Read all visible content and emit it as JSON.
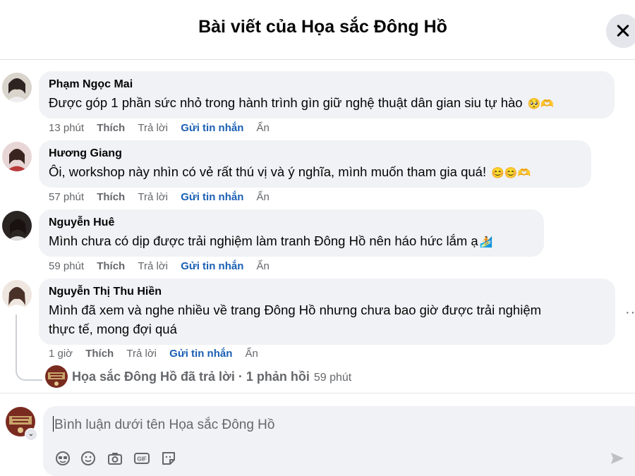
{
  "header": {
    "title": "Bài viết của Họa sắc Đông Hồ"
  },
  "comments": [
    {
      "author": "Phạm Ngọc Mai",
      "text": "Được góp 1 phần sức nhỏ trong hành trình gìn giữ nghệ thuật dân gian siu tự hào",
      "emoji": "🥺🫶",
      "time": "13 phút",
      "like": "Thích",
      "reply": "Trả lời",
      "message": "Gửi tin nhắn",
      "hide": "Ẩn"
    },
    {
      "author": "Hương Giang",
      "text": "Ôi, workshop này nhìn có vẻ rất thú vị và ý nghĩa, mình muốn tham gia quá!",
      "emoji": "😊😊🫶",
      "time": "57 phút",
      "like": "Thích",
      "reply": "Trả lời",
      "message": "Gửi tin nhắn",
      "hide": "Ẩn"
    },
    {
      "author": "Nguyễn Huê",
      "text": "Mình chưa có dịp được trải nghiệm làm tranh Đông Hồ nên háo hức lắm ạ",
      "emoji": "🏄",
      "time": "59 phút",
      "like": "Thích",
      "reply": "Trả lời",
      "message": "Gửi tin nhắn",
      "hide": "Ẩn"
    },
    {
      "author": "Nguyễn Thị Thu Hiền",
      "text_line1": "Mình đã xem và nghe nhiều về trang Đông Hồ nhưng chưa bao giờ được trải nghiệm",
      "text_line2": "thực tế, mong đợi quá",
      "time": "1 giờ",
      "like": "Thích",
      "reply": "Trả lời",
      "message": "Gửi tin nhắn",
      "hide": "Ẩn"
    }
  ],
  "reply_summary": {
    "text": "Họa sắc Đông Hồ đã trả lời · 1 phản hồi",
    "time": "59 phút"
  },
  "more_options": "···",
  "composer": {
    "placeholder": "Bình luận dưới tên Họa sắc Đông Hồ",
    "tools": [
      "avatar-sticker-icon",
      "emoji-icon",
      "camera-icon",
      "gif-icon",
      "sticker-icon"
    ],
    "send_icon": "send-icon"
  },
  "colors": {
    "bubble": "#f0f2f5",
    "secondary_text": "#65676b",
    "message_link": "#1a5fb4",
    "close_bg": "#e4e6eb"
  }
}
